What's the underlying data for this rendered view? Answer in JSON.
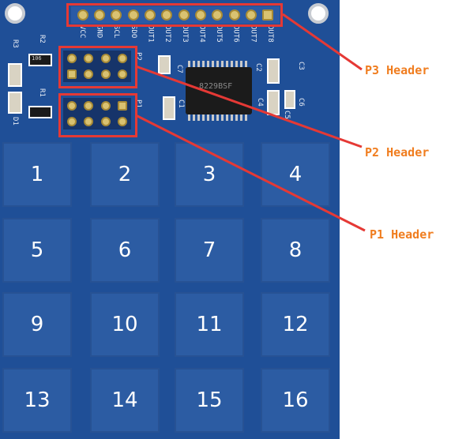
{
  "board": {
    "color": "#1f4f97",
    "pad_color": "#2c5ca3",
    "pin_labels": [
      "VCC",
      "GND",
      "SCL",
      "SDO",
      "OUT1",
      "OUT2",
      "OUT3",
      "OUT4",
      "OUT5",
      "OUT6",
      "OUT7",
      "OUT8"
    ],
    "component_labels": {
      "r3": "R3",
      "r2": "R2",
      "r1": "R1",
      "d1": "D1",
      "c1": "C1",
      "c2": "C2",
      "c3": "C3",
      "c4": "C4",
      "c5": "C5",
      "c6": "C6",
      "c7": "C7",
      "p1": "P1",
      "p2": "P2",
      "chip": "8229BSF",
      "res_code": "106"
    },
    "pads": [
      "1",
      "2",
      "3",
      "4",
      "5",
      "6",
      "7",
      "8",
      "9",
      "10",
      "11",
      "12",
      "13",
      "14",
      "15",
      "16"
    ]
  },
  "annotations": {
    "color": "#e53935",
    "label_color": "#f07d1f",
    "p3": "P3 Header",
    "p2": "P2  Header",
    "p1": "P1  Header"
  }
}
